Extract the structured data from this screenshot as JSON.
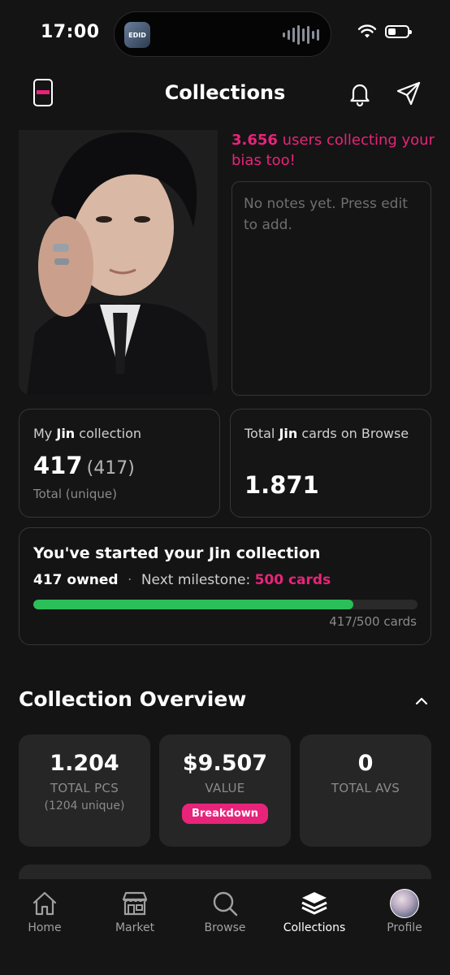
{
  "status_bar": {
    "time": "17:00",
    "island_app_label": "EDID"
  },
  "header": {
    "title": "Collections"
  },
  "bias": {
    "users_count": "3.656",
    "users_text": " users collecting your bias too!",
    "notes_placeholder": "No notes yet. Press edit to add."
  },
  "my_collection": {
    "label_prefix": "My ",
    "member": "Jin",
    "label_suffix": " collection",
    "count": "417",
    "unique": "(417)",
    "caption": "Total (unique)"
  },
  "browse_total": {
    "label_prefix": "Total ",
    "member": "Jin",
    "label_suffix": " cards on Browse",
    "count": "1.871"
  },
  "progress": {
    "title": "You've started your Jin collection",
    "owned": "417 owned",
    "separator": "·",
    "milestone_label": "Next milestone:",
    "milestone_value": "500 cards",
    "fraction": 0.834,
    "count_text": "417/500 cards"
  },
  "overview": {
    "title": "Collection Overview",
    "cards": [
      {
        "value": "1.204",
        "label": "TOTAL PCS",
        "sub": "(1204 unique)"
      },
      {
        "value": "$9.507",
        "label": "VALUE",
        "button": "Breakdown"
      },
      {
        "value": "0",
        "label": "TOTAL AVS"
      }
    ]
  },
  "nav": {
    "items": [
      {
        "label": "Home",
        "icon": "home-icon"
      },
      {
        "label": "Market",
        "icon": "store-icon"
      },
      {
        "label": "Browse",
        "icon": "search-icon"
      },
      {
        "label": "Collections",
        "icon": "layers-icon",
        "active": true
      },
      {
        "label": "Profile",
        "icon": "avatar"
      }
    ]
  },
  "colors": {
    "accent": "#e8237a",
    "progress": "#2bbf5a",
    "background": "#141414"
  }
}
